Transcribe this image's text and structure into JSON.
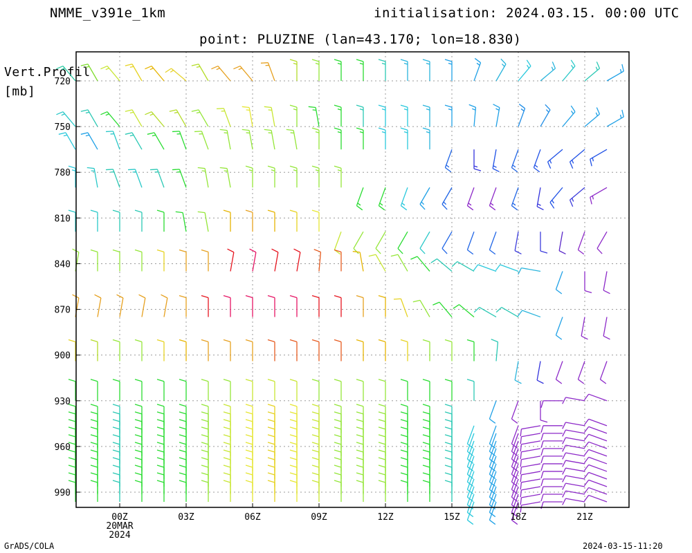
{
  "header": {
    "model": "NMME_v391e_1km",
    "init": "initialisation: 2024.03.15. 00:00 UTC",
    "point": "point: PLUZINE (lan=43.170; lon=18.830)"
  },
  "footer": {
    "left": "GrADS/COLA",
    "right": "2024-03-15-11:20"
  },
  "chart_data": {
    "type": "wind-barb-time-height",
    "title": "point: PLUZINE (lan=43.170; lon=18.830)",
    "ylabel_lines": [
      "Vert.Profil",
      "[mb]"
    ],
    "y_unit": "mb",
    "y_axis": {
      "min": 720,
      "max": 1000,
      "inverted": true,
      "ticks": [
        720,
        750,
        780,
        810,
        840,
        870,
        900,
        930,
        960,
        990
      ]
    },
    "x_axis": {
      "ticks": [
        {
          "hour": 0,
          "lines": [
            "00Z",
            "20MAR",
            "2024"
          ]
        },
        {
          "hour": 3,
          "lines": [
            "03Z"
          ]
        },
        {
          "hour": 6,
          "lines": [
            "06Z"
          ]
        },
        {
          "hour": 9,
          "lines": [
            "09Z"
          ]
        },
        {
          "hour": 12,
          "lines": [
            "12Z"
          ]
        },
        {
          "hour": 15,
          "lines": [
            "15Z"
          ]
        },
        {
          "hour": 18,
          "lines": [
            "18Z"
          ]
        },
        {
          "hour": 21,
          "lines": [
            "21Z"
          ]
        }
      ],
      "range_hours": [
        -2,
        23
      ]
    },
    "grid": true,
    "levels": [
      720,
      750,
      765,
      790,
      819,
      845,
      875,
      904,
      930,
      945,
      950,
      955,
      960,
      965,
      970,
      975,
      980,
      985,
      990,
      995
    ],
    "times": [
      -2,
      -1,
      0,
      1,
      2,
      3,
      4,
      5,
      6,
      7,
      8,
      9,
      10,
      11,
      12,
      13,
      14,
      15,
      16,
      17,
      18,
      19,
      20,
      21,
      22
    ],
    "barb_columns": [
      {
        "level": 720,
        "speed": 10,
        "dir": [
          340,
          320,
          310,
          300,
          300,
          300,
          290,
          280,
          280,
          275,
          270,
          270,
          270,
          270,
          270,
          275,
          280,
          285,
          290,
          300,
          300,
          305,
          310,
          315,
          320
        ],
        "color": [
          "#27c8a0",
          "#7ddc2c",
          "#c8e632",
          "#e6d220",
          "#e6b400",
          "#e6d22a",
          "#b4dc28",
          "#e6a01e",
          "#e6a01e",
          "#e6a01e",
          "#b4dc28",
          "#94e638",
          "#28dc30",
          "#28dc30",
          "#2ac8b4",
          "#28b4dc",
          "#28b4dc",
          "#1ea0e6",
          "#1ea0e6",
          "#28b4dc",
          "#28c8dc",
          "#28b4dc",
          "#28c8c8",
          "#2ac8b4",
          "#1ea0e6"
        ]
      },
      {
        "level": 750,
        "speed": 10,
        "dir": [
          330,
          320,
          310,
          300,
          300,
          295,
          290,
          285,
          280,
          275,
          275,
          275,
          275,
          275,
          275,
          275,
          280,
          280,
          285,
          290,
          295,
          300,
          305,
          310,
          315
        ],
        "color": [
          "#28c8c8",
          "#2ac8b4",
          "#28dc30",
          "#c8e632",
          "#b4dc28",
          "#b4dc28",
          "#94e638",
          "#c8e632",
          "#e6e632",
          "#c8e632",
          "#94e638",
          "#28dc30",
          "#28dc30",
          "#2ac8b4",
          "#28c8dc",
          "#28c8dc",
          "#28b4dc",
          "#1ea0e6",
          "#1ea0e6",
          "#1ea0e6",
          "#1e8ce6",
          "#1e8ce6",
          "#1ea0e6",
          "#1ea0e6",
          "#1ea0e6"
        ]
      }
    ]
  }
}
